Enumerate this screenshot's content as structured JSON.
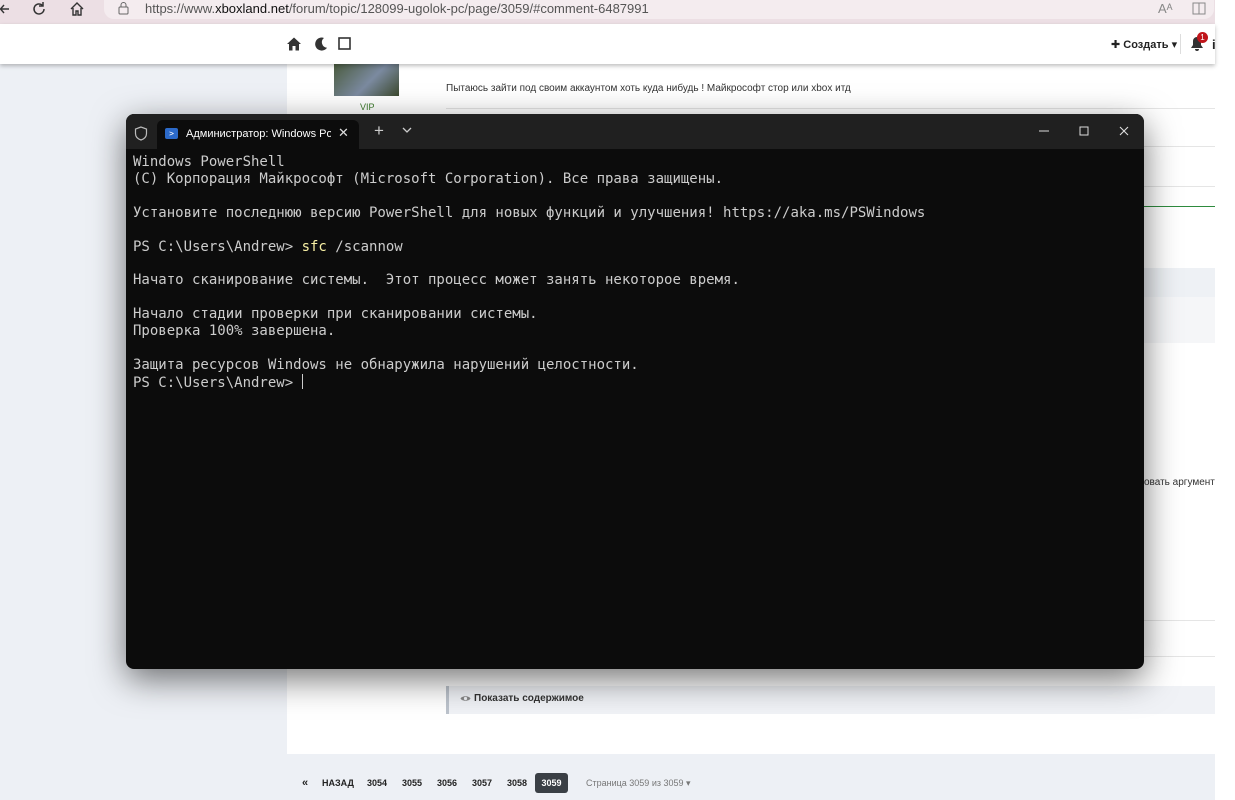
{
  "browser": {
    "url_prefix": "https://www.",
    "url_domain": "xboxland.net",
    "url_path": "/forum/topic/128099-ugolok-pc/page/3059/#comment-6487991"
  },
  "site_header": {
    "create_label": "Создать",
    "notification_count": "1"
  },
  "post": {
    "user_badge": "VIP",
    "text": "Пытаюсь зайти под своим аккаунтом хоть куда нибудь ! Майкрософт стор или xbox итд"
  },
  "background_cut_text": "овать аргумент",
  "spoiler": {
    "label": "Показать содержимое"
  },
  "pagination": {
    "back_label": "НАЗАД",
    "pages": [
      "3054",
      "3055",
      "3056",
      "3057",
      "3058",
      "3059"
    ],
    "current": "3059",
    "page_info": "Страница 3059 из 3059"
  },
  "terminal": {
    "tab_title": "Администратор: Windows PowerShell",
    "lines": {
      "l1": "Windows PowerShell",
      "l2": "(C) Корпорация Майкрософт (Microsoft Corporation). Все права защищены.",
      "l3": "Установите последнюю версию PowerShell для новых функций и улучшения! https://aka.ms/PSWindows",
      "prompt": "PS C:\\Users\\Andrew> ",
      "cmd_name": "sfc",
      "cmd_args": " /scannow",
      "l5": "Начато сканирование системы.  Этот процесс может занять некоторое время.",
      "l6": "Начало стадии проверки при сканировании системы.",
      "l7": "Проверка 100% завершена.",
      "l8": "Защита ресурсов Windows не обнаружила нарушений целостности."
    }
  }
}
